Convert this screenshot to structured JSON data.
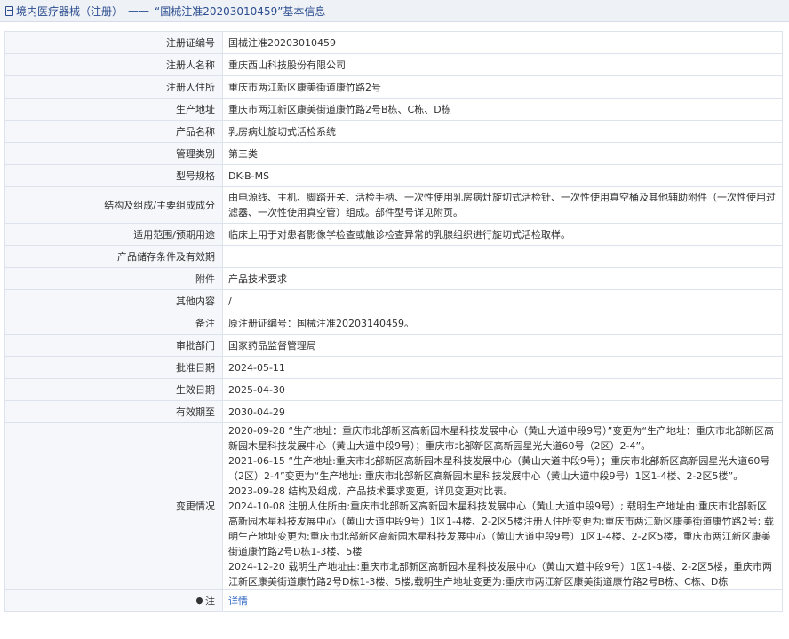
{
  "header": {
    "breadcrumb_label": "境内医疗器械（注册）",
    "separator": "——",
    "title": "“国械注准20203010459”基本信息"
  },
  "rows": [
    {
      "label": "注册证编号",
      "value": "国械注准20203010459"
    },
    {
      "label": "注册人名称",
      "value": "重庆西山科技股份有限公司"
    },
    {
      "label": "注册人住所",
      "value": "重庆市两江新区康美街道康竹路2号"
    },
    {
      "label": "生产地址",
      "value": "重庆市两江新区康美街道康竹路2号B栋、C栋、D栋"
    },
    {
      "label": "产品名称",
      "value": "乳房病灶旋切式活检系统"
    },
    {
      "label": "管理类别",
      "value": "第三类"
    },
    {
      "label": "型号规格",
      "value": "DK-B-MS"
    },
    {
      "label": "结构及组成/主要组成成分",
      "value": "由电源线、主机、脚踏开关、活检手柄、一次性使用乳房病灶旋切式活检针、一次性使用真空桶及其他辅助附件（一次性使用过滤器、一次性使用真空管）组成。部件型号详见附页。"
    },
    {
      "label": "适用范围/预期用途",
      "value": "临床上用于对患者影像学检查或触诊检查异常的乳腺组织进行旋切式活检取样。"
    },
    {
      "label": "产品储存条件及有效期",
      "value": ""
    },
    {
      "label": "附件",
      "value": "产品技术要求"
    },
    {
      "label": "其他内容",
      "value": "/"
    },
    {
      "label": "备注",
      "value": "原注册证编号：国械注准20203140459。"
    },
    {
      "label": "审批部门",
      "value": "国家药品监督管理局"
    },
    {
      "label": "批准日期",
      "value": "2024-05-11"
    },
    {
      "label": "生效日期",
      "value": "2025-04-30"
    },
    {
      "label": "有效期至",
      "value": "2030-04-29"
    }
  ],
  "changes": {
    "label": "变更情况",
    "entries": [
      "2020-09-28 “生产地址：重庆市北部新区高新园木星科技发展中心（黄山大道中段9号）”变更为“生产地址：重庆市北部新区高新园木星科技发展中心（黄山大道中段9号）；重庆市北部新区高新园星光大道60号（2区）2-4”。",
      "2021-06-15 “生产地址:重庆市北部新区高新园木星科技发展中心（黄山大道中段9号）；重庆市北部新区高新园星光大道60号（2区）2-4”变更为“生产地址: 重庆市北部新区高新园木星科技发展中心（黄山大道中段9号）1区1-4楼、2-2区5楼”。",
      "2023-09-28 结构及组成，产品技术要求变更，详见变更对比表。",
      "2024-10-08 注册人住所由:重庆市北部新区高新园木星科技发展中心（黄山大道中段9号）; 载明生产地址由:重庆市北部新区高新园木星科技发展中心（黄山大道中段9号）1区1-4楼、2-2区5楼注册人住所变更为:重庆市两江新区康美街道康竹路2号; 载明生产地址变更为:重庆市北部新区高新园木星科技发展中心（黄山大道中段9号）1区1-4楼、2-2区5楼，重庆市两江新区康美街道康竹路2号D栋1-3楼、5楼",
      "2024-12-20 载明生产地址由:重庆市北部新区高新园木星科技发展中心（黄山大道中段9号）1区1-4楼、2-2区5楼，重庆市两江新区康美街道康竹路2号D栋1-3楼、5楼,载明生产地址变更为:重庆市两江新区康美街道康竹路2号B栋、C栋、D栋"
    ]
  },
  "note": {
    "label": "注",
    "icon": "pin-icon",
    "link_text": "详情"
  },
  "colors": {
    "header_bg": "#eef1f6",
    "header_text": "#2b4d8f",
    "label_bg": "#f5f7fa",
    "border": "#dde3ec",
    "link": "#2f66c3"
  }
}
